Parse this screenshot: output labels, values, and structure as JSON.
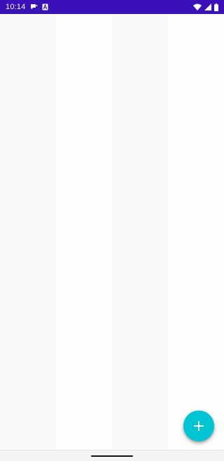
{
  "status_bar": {
    "time": "10:14",
    "left_icons": [
      "chat-notification-icon",
      "a-notification-icon"
    ],
    "right_icons": [
      "wifi-icon",
      "signal-icon",
      "battery-icon"
    ],
    "background": "#3a10b8"
  },
  "fab": {
    "icon": "plus-icon",
    "color": "#00c4d3"
  }
}
